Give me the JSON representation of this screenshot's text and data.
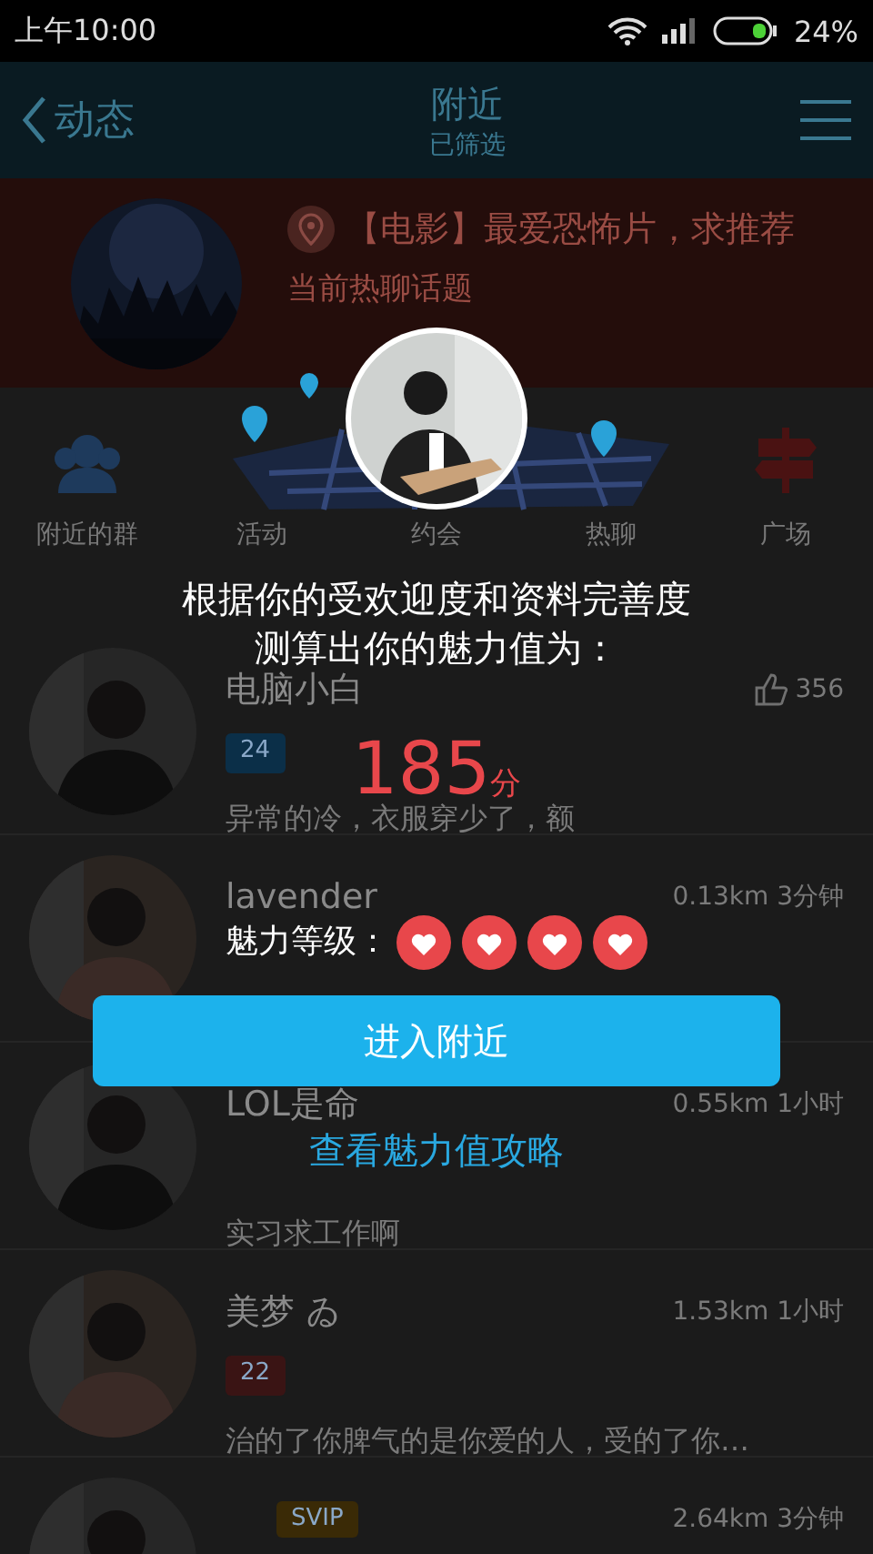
{
  "status_bar": {
    "time": "上午10:00",
    "battery": "24%"
  },
  "header": {
    "back": "动态",
    "title": "附近",
    "subtitle": "已筛选"
  },
  "banner": {
    "topic": "【电影】最爱恐怖片，求推荐",
    "caption": "当前热聊话题"
  },
  "categories": [
    {
      "label": "附近的群",
      "kind": "group"
    },
    {
      "label": "活动",
      "kind": "activity"
    },
    {
      "label": "约会",
      "kind": "date"
    },
    {
      "label": "热聊",
      "kind": "chat"
    },
    {
      "label": "广场",
      "kind": "square"
    }
  ],
  "people": [
    {
      "name": "电脑小白",
      "meta": "356",
      "kind": "likes",
      "tags": [
        {
          "text": "24",
          "color": "#0b2f48"
        }
      ],
      "comment": "异常的冷，衣服穿少了，额"
    },
    {
      "name": "lavender",
      "meta": "0.13km 3分钟",
      "kind": "distance"
    },
    {
      "name": "LOL是命",
      "meta": "0.55km 1小时",
      "kind": "distance",
      "comment": "实习求工作啊"
    },
    {
      "name": "美梦 ゐ",
      "meta": "1.53km 1小时",
      "kind": "distance",
      "tags": [
        {
          "text": "22",
          "color": "#3a1414"
        }
      ],
      "comment": "治的了你脾气的是你爱的人，受的了你…"
    },
    {
      "meta": "2.64km 3分钟",
      "kind": "distance",
      "tags": [
        {
          "text": "SVIP",
          "color": "#3a2a06"
        }
      ]
    }
  ],
  "dialog": {
    "line1": "根据你的受欢迎度和资料完善度",
    "line2": "测算出你的魅力值为：",
    "score": "185",
    "unit": "分",
    "level_label": "魅力等级：",
    "stars": 4,
    "button": "进入附近",
    "link": "查看魅力值攻略"
  }
}
